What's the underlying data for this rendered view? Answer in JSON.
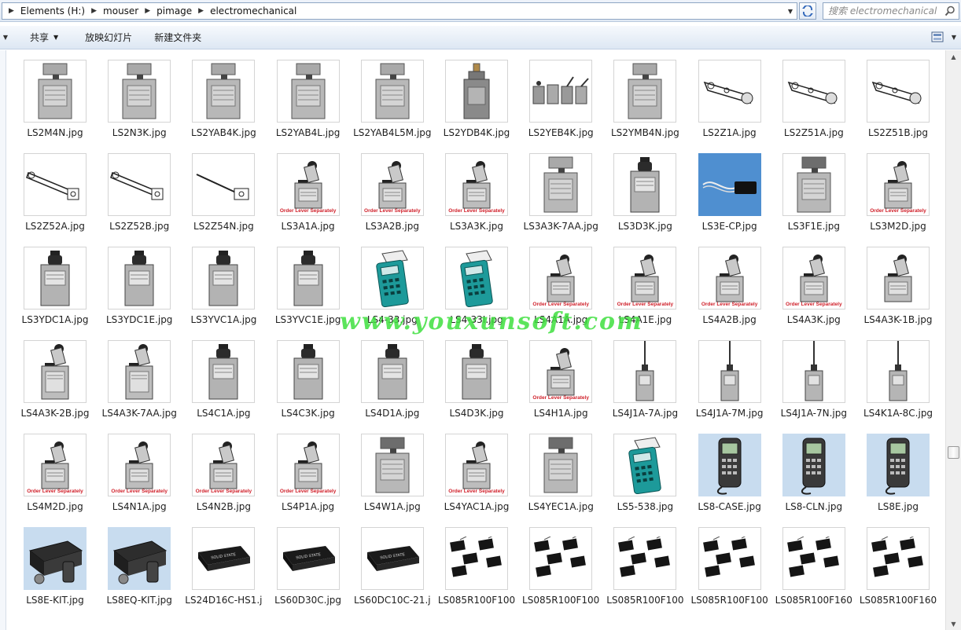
{
  "address": {
    "crumbs": [
      "Elements (H:)",
      "mouser",
      "pimage",
      "electromechanical"
    ]
  },
  "search": {
    "placeholder": "搜索 electromechanical"
  },
  "toolbar": {
    "share_label": "共享",
    "slideshow_label": "放映幻灯片",
    "new_folder_label": "新建文件夹"
  },
  "watermark": "www.youxunsoft.com",
  "files": [
    {
      "name": "LS2M4N.jpg",
      "kind": "switch",
      "ols": false
    },
    {
      "name": "LS2N3K.jpg",
      "kind": "switch",
      "ols": false
    },
    {
      "name": "LS2YAB4K.jpg",
      "kind": "switch",
      "ols": false
    },
    {
      "name": "LS2YAB4L.jpg",
      "kind": "switch",
      "ols": false
    },
    {
      "name": "LS2YAB4L5M.jpg",
      "kind": "switch",
      "ols": false
    },
    {
      "name": "LS2YDB4K.jpg",
      "kind": "plunger",
      "ols": false
    },
    {
      "name": "LS2YEB4K.jpg",
      "kind": "multi",
      "ols": false
    },
    {
      "name": "LS2YMB4N.jpg",
      "kind": "switch",
      "ols": false
    },
    {
      "name": "LS2Z1A.jpg",
      "kind": "arm",
      "ols": false
    },
    {
      "name": "LS2Z51A.jpg",
      "kind": "bentarm",
      "ols": false
    },
    {
      "name": "LS2Z51B.jpg",
      "kind": "arm",
      "ols": false
    },
    {
      "name": "LS2Z52A.jpg",
      "kind": "lever",
      "ols": false
    },
    {
      "name": "LS2Z52B.jpg",
      "kind": "lever",
      "ols": false
    },
    {
      "name": "LS2Z54N.jpg",
      "kind": "rod",
      "ols": false
    },
    {
      "name": "LS3A1A.jpg",
      "kind": "roller",
      "ols": true
    },
    {
      "name": "LS3A2B.jpg",
      "kind": "roller",
      "ols": true
    },
    {
      "name": "LS3A3K.jpg",
      "kind": "roller",
      "ols": true
    },
    {
      "name": "LS3A3K-7AA.jpg",
      "kind": "switch",
      "ols": false
    },
    {
      "name": "LS3D3K.jpg",
      "kind": "knob",
      "ols": false
    },
    {
      "name": "LS3E-CP.jpg",
      "kind": "cable",
      "ols": false
    },
    {
      "name": "LS3F1E.jpg",
      "kind": "switchdark",
      "ols": false
    },
    {
      "name": "LS3M2D.jpg",
      "kind": "roller",
      "ols": true
    },
    {
      "name": "LS3YDC1A.jpg",
      "kind": "knob",
      "ols": false
    },
    {
      "name": "LS3YDC1E.jpg",
      "kind": "knob",
      "ols": false
    },
    {
      "name": "LS3YVC1A.jpg",
      "kind": "knob",
      "ols": false
    },
    {
      "name": "LS3YVC1E.jpg",
      "kind": "knob",
      "ols": false
    },
    {
      "name": "LS4-33.jpg",
      "kind": "handheld",
      "ols": false
    },
    {
      "name": "LS4-33I.jpg",
      "kind": "handheld",
      "ols": false
    },
    {
      "name": "LS4A1A.jpg",
      "kind": "roller",
      "ols": true
    },
    {
      "name": "LS4A1E.jpg",
      "kind": "roller",
      "ols": true
    },
    {
      "name": "LS4A2B.jpg",
      "kind": "roller",
      "ols": true
    },
    {
      "name": "LS4A3K.jpg",
      "kind": "roller",
      "ols": true
    },
    {
      "name": "LS4A3K-1B.jpg",
      "kind": "roller",
      "ols": false
    },
    {
      "name": "LS4A3K-2B.jpg",
      "kind": "tallroller",
      "ols": false
    },
    {
      "name": "LS4A3K-7AA.jpg",
      "kind": "tallroller",
      "ols": false
    },
    {
      "name": "LS4C1A.jpg",
      "kind": "knob",
      "ols": false
    },
    {
      "name": "LS4C3K.jpg",
      "kind": "knob",
      "ols": false
    },
    {
      "name": "LS4D1A.jpg",
      "kind": "knob",
      "ols": false
    },
    {
      "name": "LS4D3K.jpg",
      "kind": "knob",
      "ols": false
    },
    {
      "name": "LS4H1A.jpg",
      "kind": "roller",
      "ols": true
    },
    {
      "name": "LS4J1A-7A.jpg",
      "kind": "wand",
      "ols": false
    },
    {
      "name": "LS4J1A-7M.jpg",
      "kind": "wand",
      "ols": false
    },
    {
      "name": "LS4J1A-7N.jpg",
      "kind": "wand",
      "ols": false
    },
    {
      "name": "LS4K1A-8C.jpg",
      "kind": "wand",
      "ols": false
    },
    {
      "name": "LS4M2D.jpg",
      "kind": "roller",
      "ols": true
    },
    {
      "name": "LS4N1A.jpg",
      "kind": "roller",
      "ols": true
    },
    {
      "name": "LS4N2B.jpg",
      "kind": "roller",
      "ols": true
    },
    {
      "name": "LS4P1A.jpg",
      "kind": "roller",
      "ols": true
    },
    {
      "name": "LS4W1A.jpg",
      "kind": "switchdark",
      "ols": false
    },
    {
      "name": "LS4YAC1A.jpg",
      "kind": "roller",
      "ols": true
    },
    {
      "name": "LS4YEC1A.jpg",
      "kind": "switchdark",
      "ols": false
    },
    {
      "name": "LS5-538.jpg",
      "kind": "handheld",
      "ols": false
    },
    {
      "name": "LS8-CASE.jpg",
      "kind": "scanner",
      "ols": false
    },
    {
      "name": "LS8-CLN.jpg",
      "kind": "scanner",
      "ols": false
    },
    {
      "name": "LS8E.jpg",
      "kind": "scanner",
      "ols": false
    },
    {
      "name": "LS8E-KIT.jpg",
      "kind": "kit",
      "ols": false
    },
    {
      "name": "LS8EQ-KIT.jpg",
      "kind": "kit",
      "ols": false
    },
    {
      "name": "LS24D16C-HS1.j",
      "kind": "relay",
      "ols": false
    },
    {
      "name": "LS60D30C.jpg",
      "kind": "relay",
      "ols": false
    },
    {
      "name": "LS60DC10C-21.j",
      "kind": "relay",
      "ols": false
    },
    {
      "name": "LS085R100F100",
      "kind": "micro",
      "ols": false
    },
    {
      "name": "LS085R100F100",
      "kind": "micro",
      "ols": false
    },
    {
      "name": "LS085R100F100",
      "kind": "micro",
      "ols": false
    },
    {
      "name": "LS085R100F100",
      "kind": "micro",
      "ols": false
    },
    {
      "name": "LS085R100F160",
      "kind": "micro",
      "ols": false
    },
    {
      "name": "LS085R100F160",
      "kind": "micro",
      "ols": false
    }
  ],
  "ols_label": "Order Lever Separately"
}
